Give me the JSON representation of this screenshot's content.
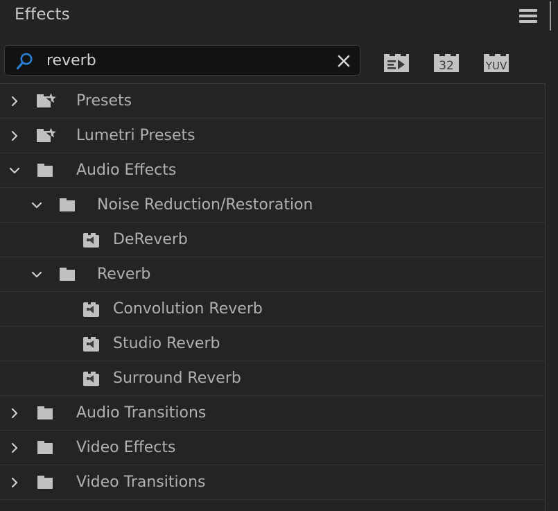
{
  "header": {
    "title": "Effects",
    "menu_icon": "hamburger-menu-icon"
  },
  "search": {
    "value": "reverb",
    "placeholder": "",
    "search_icon": "magnifier-icon",
    "clear_icon": "close-x-icon",
    "accent_color": "#2a7fd4",
    "filters": [
      {
        "id": "accelerated",
        "label": "",
        "icon": "accelerated-effects-icon",
        "tooltip": "Accelerated Effects"
      },
      {
        "id": "bit32",
        "label": "32",
        "icon": "32-bit-color-icon",
        "tooltip": "32 Bit Color"
      },
      {
        "id": "yuv",
        "label": "YUV",
        "icon": "yuv-color-icon",
        "tooltip": "YUV Color"
      }
    ]
  },
  "tree": {
    "rows": [
      {
        "label": "Presets",
        "level": 0,
        "icon": "folder-star-icon",
        "twisty": "collapsed"
      },
      {
        "label": "Lumetri Presets",
        "level": 0,
        "icon": "folder-star-icon",
        "twisty": "collapsed"
      },
      {
        "label": "Audio Effects",
        "level": 0,
        "icon": "folder-icon",
        "twisty": "expanded"
      },
      {
        "label": "Noise Reduction/Restoration",
        "level": 1,
        "icon": "folder-icon",
        "twisty": "expanded"
      },
      {
        "label": "DeReverb",
        "level": 2,
        "icon": "audio-effect-icon",
        "twisty": "none"
      },
      {
        "label": "Reverb",
        "level": 1,
        "icon": "folder-icon",
        "twisty": "expanded"
      },
      {
        "label": "Convolution Reverb",
        "level": 2,
        "icon": "audio-effect-icon",
        "twisty": "none"
      },
      {
        "label": "Studio Reverb",
        "level": 2,
        "icon": "audio-effect-icon",
        "twisty": "none"
      },
      {
        "label": "Surround Reverb",
        "level": 2,
        "icon": "audio-effect-icon",
        "twisty": "none"
      },
      {
        "label": "Audio Transitions",
        "level": 0,
        "icon": "folder-icon",
        "twisty": "collapsed"
      },
      {
        "label": "Video Effects",
        "level": 0,
        "icon": "folder-icon",
        "twisty": "collapsed"
      },
      {
        "label": "Video Transitions",
        "level": 0,
        "icon": "folder-icon",
        "twisty": "collapsed"
      }
    ]
  },
  "colors": {
    "panel_bg": "#232323",
    "row_bg": "#242424",
    "row_separator": "#333333",
    "text": "#b0b0b0",
    "icon_gray": "#c0c0c0"
  }
}
